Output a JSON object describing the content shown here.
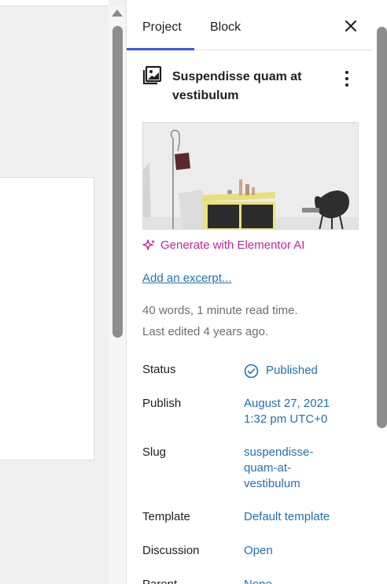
{
  "sidebar": {
    "tabs": [
      {
        "label": "Project",
        "active": true
      },
      {
        "label": "Block",
        "active": false
      }
    ],
    "close_icon": "close-icon",
    "post": {
      "title": "Suspendisse quam at vestibulum",
      "icon": "gallery-icon"
    },
    "ai_link": "Generate with Elementor AI",
    "excerpt_link": "Add an excerpt...",
    "word_count": "40 words, 1 minute read time.",
    "last_edited": "Last edited 4 years ago.",
    "rows": {
      "status": {
        "label": "Status",
        "value": "Published"
      },
      "publish": {
        "label": "Publish",
        "value": "August 27, 2021\n1:32 pm UTC+0"
      },
      "slug": {
        "label": "Slug",
        "value": "suspendisse-\nquam-at-\nvestibulum"
      },
      "template": {
        "label": "Template",
        "value": "Default template"
      },
      "discussion": {
        "label": "Discussion",
        "value": "Open"
      },
      "parent": {
        "label": "Parent",
        "value": "None"
      }
    }
  },
  "colors": {
    "accent": "#3858e9",
    "link": "#2271b1",
    "ai": "#c2249e"
  }
}
